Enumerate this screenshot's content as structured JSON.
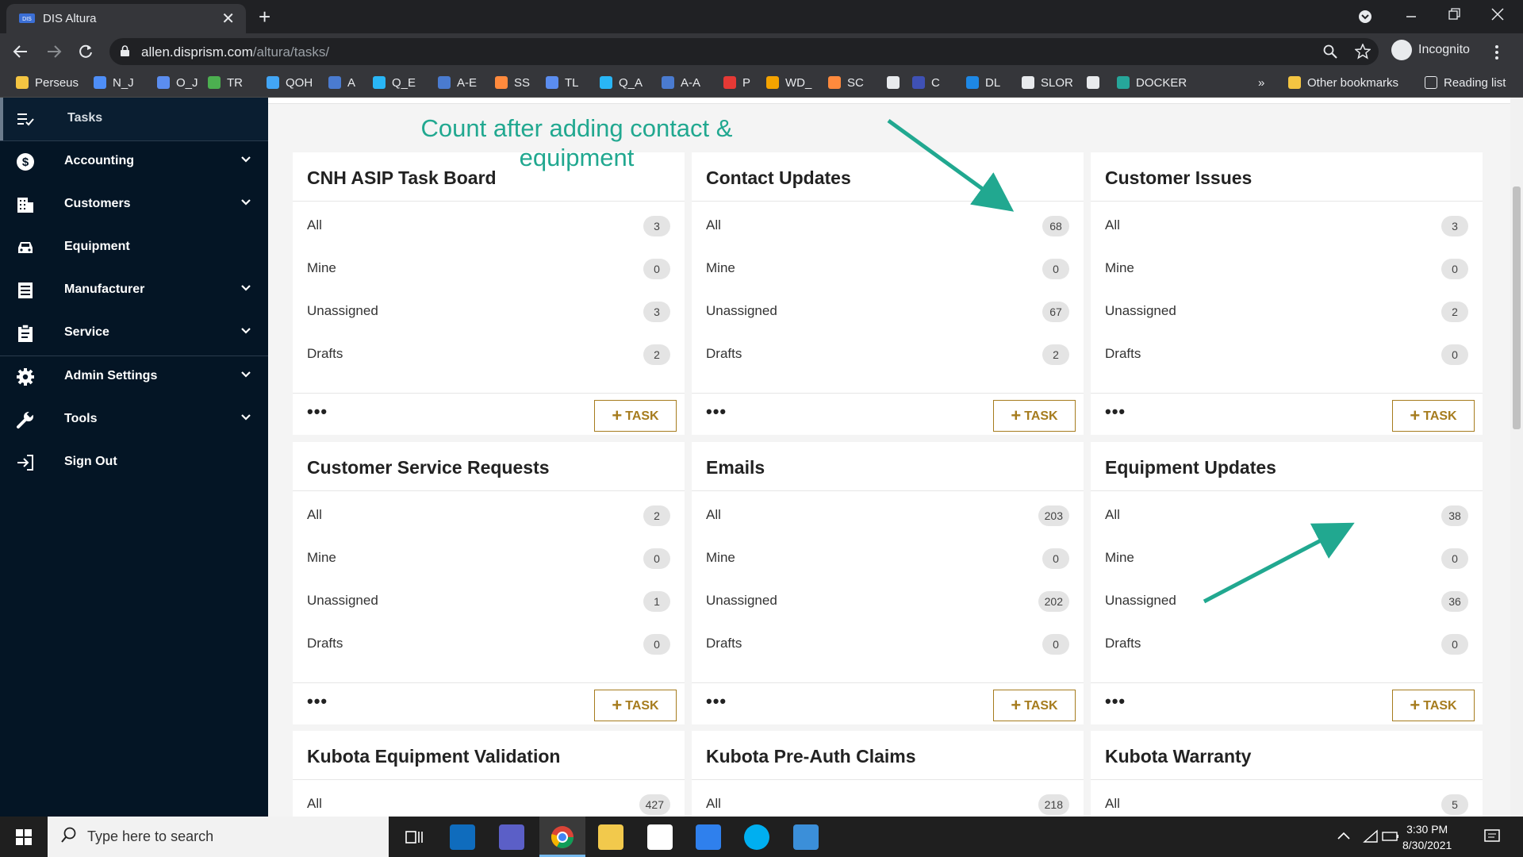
{
  "browser": {
    "tab_title": "DIS Altura",
    "tab_close": "✕",
    "new_tab": "+",
    "url_host": "allen.disprism.com",
    "url_path": "/altura/tasks/",
    "profile_label": "Incognito",
    "bookmarks": [
      {
        "label": "Perseus",
        "color": "#f4c542"
      },
      {
        "label": "N_J",
        "color": "#4e8ef7"
      },
      {
        "label": "O_J",
        "color": "#5b8def"
      },
      {
        "label": "TR",
        "color": "#4caf50"
      },
      {
        "label": "QOH",
        "color": "#42a5f5"
      },
      {
        "label": "A",
        "color": "#4a7bd0"
      },
      {
        "label": "Q_E",
        "color": "#29b6f6"
      },
      {
        "label": "A-E",
        "color": "#4a7bd0"
      },
      {
        "label": "SS",
        "color": "#ff8a3d"
      },
      {
        "label": "TL",
        "color": "#5b8def"
      },
      {
        "label": "Q_A",
        "color": "#29b6f6"
      },
      {
        "label": "A-A",
        "color": "#4a7bd0"
      },
      {
        "label": "P",
        "color": "#e53935"
      },
      {
        "label": "WD_",
        "color": "#f4a300"
      },
      {
        "label": "SC",
        "color": "#ff8a3d"
      },
      {
        "label": "",
        "color": "#e8eaed"
      },
      {
        "label": "C",
        "color": "#3f51b5"
      },
      {
        "label": "DL",
        "color": "#1e88e5"
      },
      {
        "label": "SLOR",
        "color": "#e8eaed"
      },
      {
        "label": "",
        "color": "#e8eaed"
      },
      {
        "label": "DOCKER",
        "color": "#26a69a"
      }
    ],
    "bookmarks_overflow": "»",
    "other_bookmarks": "Other bookmarks",
    "reading_list": "Reading list"
  },
  "sidebar": {
    "items": [
      {
        "label": "Tasks",
        "icon": "tasks-icon",
        "active": true,
        "chevron": false
      },
      {
        "label": "Accounting",
        "icon": "dollar-icon",
        "chevron": true
      },
      {
        "label": "Customers",
        "icon": "building-icon",
        "chevron": true
      },
      {
        "label": "Equipment",
        "icon": "car-icon",
        "chevron": false
      },
      {
        "label": "Manufacturer",
        "icon": "document-icon",
        "chevron": true
      },
      {
        "label": "Service",
        "icon": "clipboard-icon",
        "chevron": true
      },
      {
        "label": "Admin Settings",
        "icon": "gear-icon",
        "chevron": true
      },
      {
        "label": "Tools",
        "icon": "wrench-icon",
        "chevron": true
      },
      {
        "label": "Sign Out",
        "icon": "sign-out-icon",
        "chevron": false
      }
    ]
  },
  "annotation": {
    "text": "Count after adding contact & equipment",
    "color": "#21a890"
  },
  "task_button_label": "TASK",
  "more_label": "•••",
  "cards": [
    {
      "title": "CNH ASIP Task Board",
      "rows": [
        {
          "label": "All",
          "count": "3"
        },
        {
          "label": "Mine",
          "count": "0"
        },
        {
          "label": "Unassigned",
          "count": "3"
        },
        {
          "label": "Drafts",
          "count": "2"
        }
      ]
    },
    {
      "title": "Contact Updates",
      "rows": [
        {
          "label": "All",
          "count": "68"
        },
        {
          "label": "Mine",
          "count": "0"
        },
        {
          "label": "Unassigned",
          "count": "67"
        },
        {
          "label": "Drafts",
          "count": "2"
        }
      ]
    },
    {
      "title": "Customer Issues",
      "rows": [
        {
          "label": "All",
          "count": "3"
        },
        {
          "label": "Mine",
          "count": "0"
        },
        {
          "label": "Unassigned",
          "count": "2"
        },
        {
          "label": "Drafts",
          "count": "0"
        }
      ]
    },
    {
      "title": "Customer Service Requests",
      "rows": [
        {
          "label": "All",
          "count": "2"
        },
        {
          "label": "Mine",
          "count": "0"
        },
        {
          "label": "Unassigned",
          "count": "1"
        },
        {
          "label": "Drafts",
          "count": "0"
        }
      ]
    },
    {
      "title": "Emails",
      "rows": [
        {
          "label": "All",
          "count": "203"
        },
        {
          "label": "Mine",
          "count": "0"
        },
        {
          "label": "Unassigned",
          "count": "202"
        },
        {
          "label": "Drafts",
          "count": "0"
        }
      ]
    },
    {
      "title": "Equipment Updates",
      "rows": [
        {
          "label": "All",
          "count": "38"
        },
        {
          "label": "Mine",
          "count": "0"
        },
        {
          "label": "Unassigned",
          "count": "36"
        },
        {
          "label": "Drafts",
          "count": "0"
        }
      ]
    },
    {
      "title": "Kubota Equipment Validation",
      "rows": [
        {
          "label": "All",
          "count": "427"
        }
      ]
    },
    {
      "title": "Kubota Pre-Auth Claims",
      "rows": [
        {
          "label": "All",
          "count": "218"
        }
      ]
    },
    {
      "title": "Kubota Warranty",
      "rows": [
        {
          "label": "All",
          "count": "5"
        }
      ]
    }
  ],
  "taskbar": {
    "search_placeholder": "Type here to search",
    "time": "3:30 PM",
    "date": "8/30/2021"
  }
}
